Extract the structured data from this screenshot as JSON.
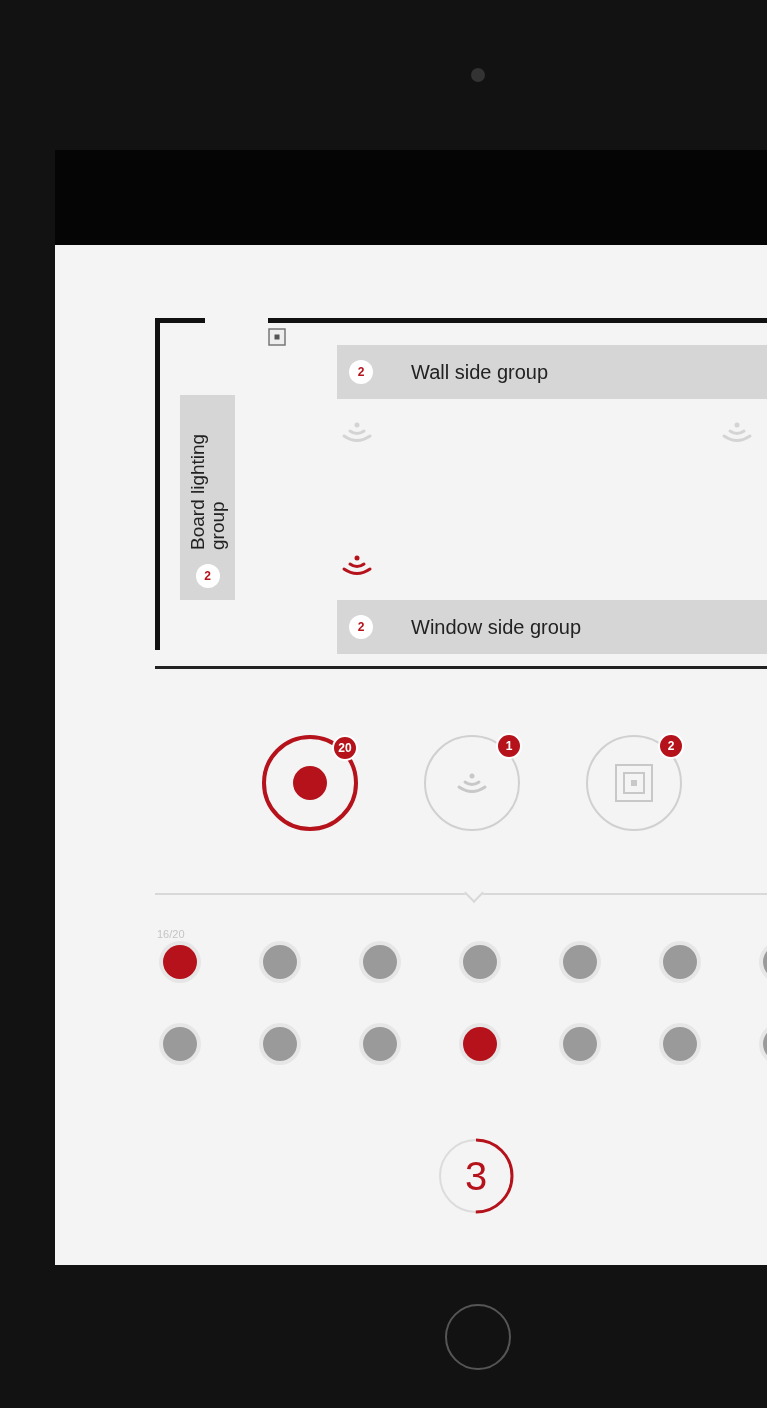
{
  "room": {
    "groups": [
      {
        "kind": "horizontal",
        "label": "Wall side group",
        "count": "2"
      },
      {
        "kind": "vertical",
        "label": "Board lighting group",
        "count": "2"
      },
      {
        "kind": "horizontal",
        "label": "Window side group",
        "count": "2"
      }
    ],
    "fixtures": [
      {
        "selected": false
      },
      {
        "selected": false
      },
      {
        "selected": true
      }
    ]
  },
  "categories": [
    {
      "kind": "dot",
      "count": "20",
      "selected": true
    },
    {
      "kind": "wireless",
      "count": "1",
      "selected": false
    },
    {
      "kind": "panel",
      "count": "2",
      "selected": false
    }
  ],
  "lights": {
    "counter": "16/20",
    "rows": [
      [
        {
          "selected": true
        },
        {
          "selected": false
        },
        {
          "selected": false
        },
        {
          "selected": false
        },
        {
          "selected": false
        },
        {
          "selected": false
        },
        {
          "selected": false
        }
      ],
      [
        {
          "selected": false
        },
        {
          "selected": false
        },
        {
          "selected": false
        },
        {
          "selected": true
        },
        {
          "selected": false
        },
        {
          "selected": false
        },
        {
          "selected": false
        }
      ]
    ]
  },
  "step": {
    "number": "3",
    "level": 0.5
  }
}
